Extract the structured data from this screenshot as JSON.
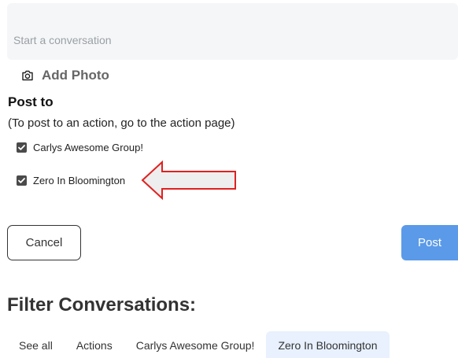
{
  "composer": {
    "placeholder": "Start a conversation"
  },
  "add_photo": {
    "icon": "camera-icon",
    "label": "Add Photo"
  },
  "post_to": {
    "title": "Post to",
    "hint": "(To post to an action, go to the action page)",
    "groups": [
      {
        "label": "Carlys Awesome Group!",
        "checked": true
      },
      {
        "label": "Zero In Bloomington",
        "checked": true
      }
    ]
  },
  "annotation": {
    "arrow_color": "#e02020",
    "direction": "left"
  },
  "buttons": {
    "cancel": "Cancel",
    "post": "Post"
  },
  "colors": {
    "post_button": "#5b9ae8",
    "active_tab": "#e8f1fd",
    "composer_bg": "#f5f6f7"
  },
  "filter": {
    "title": "Filter Conversations:",
    "tabs": [
      {
        "label": "See all",
        "active": false
      },
      {
        "label": "Actions",
        "active": false
      },
      {
        "label": "Carlys Awesome Group!",
        "active": false
      },
      {
        "label": "Zero In Bloomington",
        "active": true
      }
    ]
  }
}
